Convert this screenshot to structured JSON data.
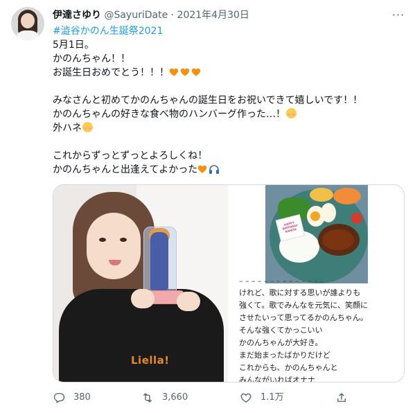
{
  "tweet": {
    "display_name": "伊達さゆり",
    "handle": "@SayuriDate",
    "separator": "·",
    "date": "2021年4月30日",
    "more_icon": "more-horizontal-icon",
    "hashtag": "#澁谷かのん生誕祭2021",
    "lines": [
      "5月1日。",
      "かのんちゃん！！",
      "お誕生日おめでとう！！！",
      "みなさんと初めてかのんちゃんの誕生日をお祝いできて嬉しいです！！",
      "かのんちゃんの好きな食べ物のハンバーグ作った…！",
      "外ハネ",
      "これからずっとずっとよろしくね！",
      "かのんちゃんと出逢えてよかった"
    ],
    "heart_color": "#f4900c",
    "hashtag_color": "#1d9bf0"
  },
  "media": {
    "left_photo": {
      "shirt_logo": "Liella!"
    },
    "right_photo": {
      "flag_text": [
        "HAPPY",
        "BIRTHDAY",
        "KANON"
      ],
      "note_lines": [
        "けれど、歌に対する思いが誰よりも",
        "強くて。歌でみんなを元気に、笑顔に",
        "させたいって思ってるかのんちゃん。",
        "そんな強くてかっこいい",
        "かのんちゃんが大好き。",
        "まだ始まったばかりだけど",
        "これからも、かのんちゃんと",
        "みんながいればオナナ"
      ]
    }
  },
  "actions": {
    "reply_count": "380",
    "retweet_count": "3,660",
    "like_count": "1.1万",
    "reply_icon": "reply-icon",
    "retweet_icon": "retweet-icon",
    "like_icon": "heart-icon",
    "share_icon": "share-icon"
  }
}
